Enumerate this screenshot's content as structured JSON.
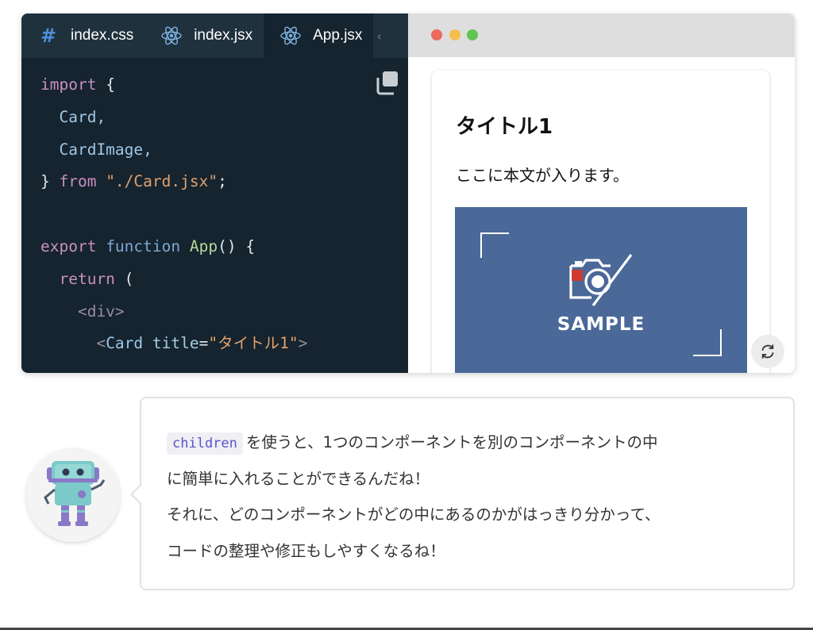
{
  "editor": {
    "tabs": [
      {
        "label": "index.css",
        "icon": "hash-icon",
        "active": false
      },
      {
        "label": "index.jsx",
        "icon": "react-icon",
        "active": false
      },
      {
        "label": "App.jsx",
        "icon": "react-icon",
        "active": true
      }
    ],
    "code": {
      "l1_kw": "import",
      "l1_rest": " {",
      "l2": "  Card,",
      "l3": "  CardImage,",
      "l4_a": "} ",
      "l4_kw": "from",
      "l4_str": " \"./Card.jsx\"",
      "l4_end": ";",
      "l6_kw1": "export",
      "l6_kw2": " function",
      "l6_fn": " App",
      "l6_end": "() {",
      "l7_kw": "  return",
      "l7_end": " (",
      "l8": "    <div>",
      "l9_open": "      <",
      "l9_comp": "Card",
      "l9_attr": " title",
      "l9_eq": "=",
      "l9_str": "\"タイトル1\"",
      "l9_close": ">"
    },
    "colors": {
      "background": "#15242f",
      "tab_bar": "#20313e"
    }
  },
  "preview": {
    "card": {
      "title": "タイトル1",
      "body": "ここに本文が入ります。",
      "image_label": "SAMPLE",
      "image_bg": "#4a6898"
    }
  },
  "bubble": {
    "chip": "children",
    "line1": "を使うと、1つのコンポーネントを別のコンポーネントの中",
    "line2": "に簡単に入れることができるんだね！",
    "line3": "それに、どのコンポーネントがどの中にあるのかがはっきり分かって、",
    "line4": "コードの整理や修正もしやすくなるね！"
  },
  "icons": [
    "hash-icon",
    "react-icon",
    "copy-icon",
    "refresh-icon",
    "camera-icon",
    "robot-avatar"
  ]
}
